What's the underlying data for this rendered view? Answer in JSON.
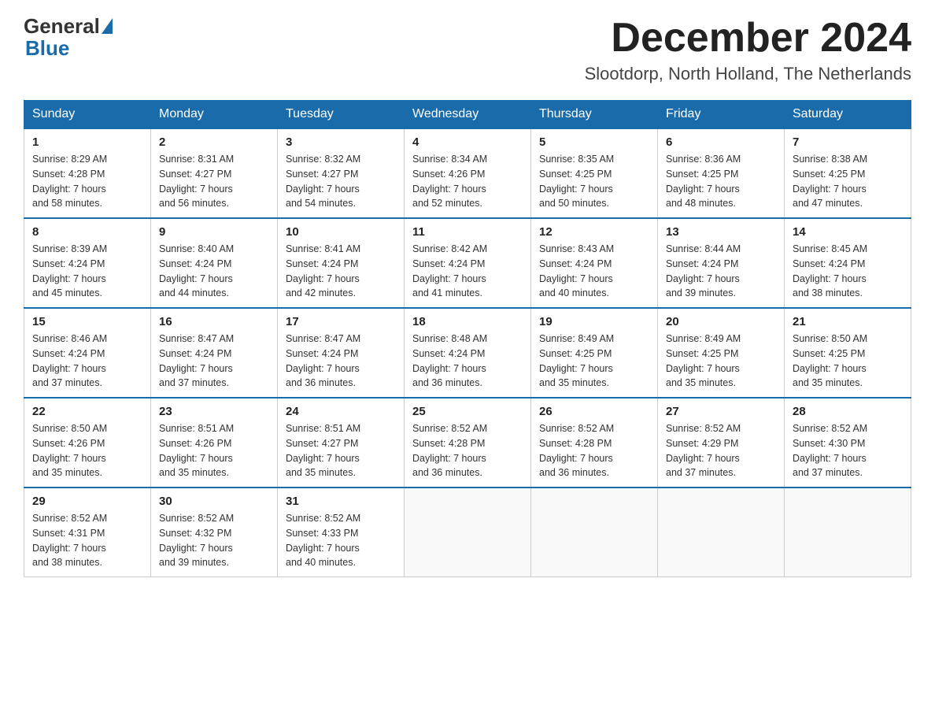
{
  "logo": {
    "general": "General",
    "blue": "Blue"
  },
  "header": {
    "month": "December 2024",
    "location": "Slootdorp, North Holland, The Netherlands"
  },
  "days_of_week": [
    "Sunday",
    "Monday",
    "Tuesday",
    "Wednesday",
    "Thursday",
    "Friday",
    "Saturday"
  ],
  "weeks": [
    [
      {
        "day": "1",
        "sunrise": "8:29 AM",
        "sunset": "4:28 PM",
        "daylight": "7 hours and 58 minutes."
      },
      {
        "day": "2",
        "sunrise": "8:31 AM",
        "sunset": "4:27 PM",
        "daylight": "7 hours and 56 minutes."
      },
      {
        "day": "3",
        "sunrise": "8:32 AM",
        "sunset": "4:27 PM",
        "daylight": "7 hours and 54 minutes."
      },
      {
        "day": "4",
        "sunrise": "8:34 AM",
        "sunset": "4:26 PM",
        "daylight": "7 hours and 52 minutes."
      },
      {
        "day": "5",
        "sunrise": "8:35 AM",
        "sunset": "4:25 PM",
        "daylight": "7 hours and 50 minutes."
      },
      {
        "day": "6",
        "sunrise": "8:36 AM",
        "sunset": "4:25 PM",
        "daylight": "7 hours and 48 minutes."
      },
      {
        "day": "7",
        "sunrise": "8:38 AM",
        "sunset": "4:25 PM",
        "daylight": "7 hours and 47 minutes."
      }
    ],
    [
      {
        "day": "8",
        "sunrise": "8:39 AM",
        "sunset": "4:24 PM",
        "daylight": "7 hours and 45 minutes."
      },
      {
        "day": "9",
        "sunrise": "8:40 AM",
        "sunset": "4:24 PM",
        "daylight": "7 hours and 44 minutes."
      },
      {
        "day": "10",
        "sunrise": "8:41 AM",
        "sunset": "4:24 PM",
        "daylight": "7 hours and 42 minutes."
      },
      {
        "day": "11",
        "sunrise": "8:42 AM",
        "sunset": "4:24 PM",
        "daylight": "7 hours and 41 minutes."
      },
      {
        "day": "12",
        "sunrise": "8:43 AM",
        "sunset": "4:24 PM",
        "daylight": "7 hours and 40 minutes."
      },
      {
        "day": "13",
        "sunrise": "8:44 AM",
        "sunset": "4:24 PM",
        "daylight": "7 hours and 39 minutes."
      },
      {
        "day": "14",
        "sunrise": "8:45 AM",
        "sunset": "4:24 PM",
        "daylight": "7 hours and 38 minutes."
      }
    ],
    [
      {
        "day": "15",
        "sunrise": "8:46 AM",
        "sunset": "4:24 PM",
        "daylight": "7 hours and 37 minutes."
      },
      {
        "day": "16",
        "sunrise": "8:47 AM",
        "sunset": "4:24 PM",
        "daylight": "7 hours and 37 minutes."
      },
      {
        "day": "17",
        "sunrise": "8:47 AM",
        "sunset": "4:24 PM",
        "daylight": "7 hours and 36 minutes."
      },
      {
        "day": "18",
        "sunrise": "8:48 AM",
        "sunset": "4:24 PM",
        "daylight": "7 hours and 36 minutes."
      },
      {
        "day": "19",
        "sunrise": "8:49 AM",
        "sunset": "4:25 PM",
        "daylight": "7 hours and 35 minutes."
      },
      {
        "day": "20",
        "sunrise": "8:49 AM",
        "sunset": "4:25 PM",
        "daylight": "7 hours and 35 minutes."
      },
      {
        "day": "21",
        "sunrise": "8:50 AM",
        "sunset": "4:25 PM",
        "daylight": "7 hours and 35 minutes."
      }
    ],
    [
      {
        "day": "22",
        "sunrise": "8:50 AM",
        "sunset": "4:26 PM",
        "daylight": "7 hours and 35 minutes."
      },
      {
        "day": "23",
        "sunrise": "8:51 AM",
        "sunset": "4:26 PM",
        "daylight": "7 hours and 35 minutes."
      },
      {
        "day": "24",
        "sunrise": "8:51 AM",
        "sunset": "4:27 PM",
        "daylight": "7 hours and 35 minutes."
      },
      {
        "day": "25",
        "sunrise": "8:52 AM",
        "sunset": "4:28 PM",
        "daylight": "7 hours and 36 minutes."
      },
      {
        "day": "26",
        "sunrise": "8:52 AM",
        "sunset": "4:28 PM",
        "daylight": "7 hours and 36 minutes."
      },
      {
        "day": "27",
        "sunrise": "8:52 AM",
        "sunset": "4:29 PM",
        "daylight": "7 hours and 37 minutes."
      },
      {
        "day": "28",
        "sunrise": "8:52 AM",
        "sunset": "4:30 PM",
        "daylight": "7 hours and 37 minutes."
      }
    ],
    [
      {
        "day": "29",
        "sunrise": "8:52 AM",
        "sunset": "4:31 PM",
        "daylight": "7 hours and 38 minutes."
      },
      {
        "day": "30",
        "sunrise": "8:52 AM",
        "sunset": "4:32 PM",
        "daylight": "7 hours and 39 minutes."
      },
      {
        "day": "31",
        "sunrise": "8:52 AM",
        "sunset": "4:33 PM",
        "daylight": "7 hours and 40 minutes."
      },
      null,
      null,
      null,
      null
    ]
  ],
  "labels": {
    "sunrise": "Sunrise:",
    "sunset": "Sunset:",
    "daylight": "Daylight:"
  }
}
